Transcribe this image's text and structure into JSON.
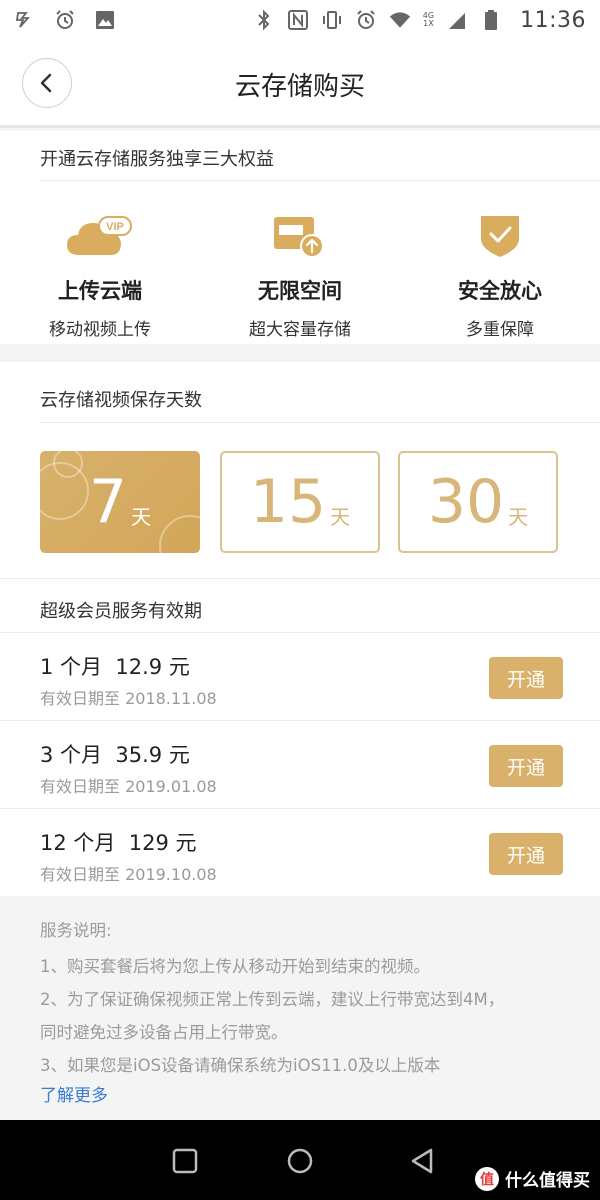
{
  "status_bar": {
    "time": "11:36",
    "network_top": "4G",
    "network_bottom": "1X",
    "icons": [
      "app-icon",
      "alarm-icon",
      "image-icon",
      "bluetooth-icon",
      "nfc-icon",
      "vibrate-icon",
      "alarm-icon",
      "wifi-icon",
      "signal-icon",
      "battery-icon"
    ]
  },
  "header": {
    "title": "云存储购买"
  },
  "benefits": {
    "title": "开通云存储服务独享三大权益",
    "items": [
      {
        "title": "上传云端",
        "subtitle": "移动视频上传",
        "icon": "vip-cloud-icon"
      },
      {
        "title": "无限空间",
        "subtitle": "超大容量存储",
        "icon": "storage-upload-icon"
      },
      {
        "title": "安全放心",
        "subtitle": "多重保障",
        "icon": "shield-check-icon"
      }
    ]
  },
  "days": {
    "title": "云存储视频保存天数",
    "options": [
      {
        "value": "7",
        "unit": "天",
        "selected": true
      },
      {
        "value": "15",
        "unit": "天",
        "selected": false
      },
      {
        "value": "30",
        "unit": "天",
        "selected": false
      }
    ]
  },
  "plans": {
    "title": "超级会员服务有效期",
    "items": [
      {
        "name": "1 个月  12.9 元",
        "valid": "有效日期至 2018.11.08",
        "button": "开通"
      },
      {
        "name": "3 个月  35.9 元",
        "valid": "有效日期至 2019.01.08",
        "button": "开通"
      },
      {
        "name": "12 个月  129 元",
        "valid": "有效日期至 2019.10.08",
        "button": "开通"
      }
    ]
  },
  "notes": {
    "lines": [
      "服务说明:",
      "1、购买套餐后将为您上传从移动开始到结束的视频。",
      "2、为了保证确保视频正常上传到云端，建议上行带宽达到4M，",
      "同时避免过多设备占用上行带宽。",
      "3、如果您是iOS设备请确保系统为iOS11.0及以上版本"
    ],
    "link": "了解更多"
  },
  "watermark": {
    "badge": "值",
    "text": "什么值得买"
  },
  "colors": {
    "gold": "#d9b16a",
    "gold_outline": "#dcc293",
    "link": "#3a7bd5"
  }
}
